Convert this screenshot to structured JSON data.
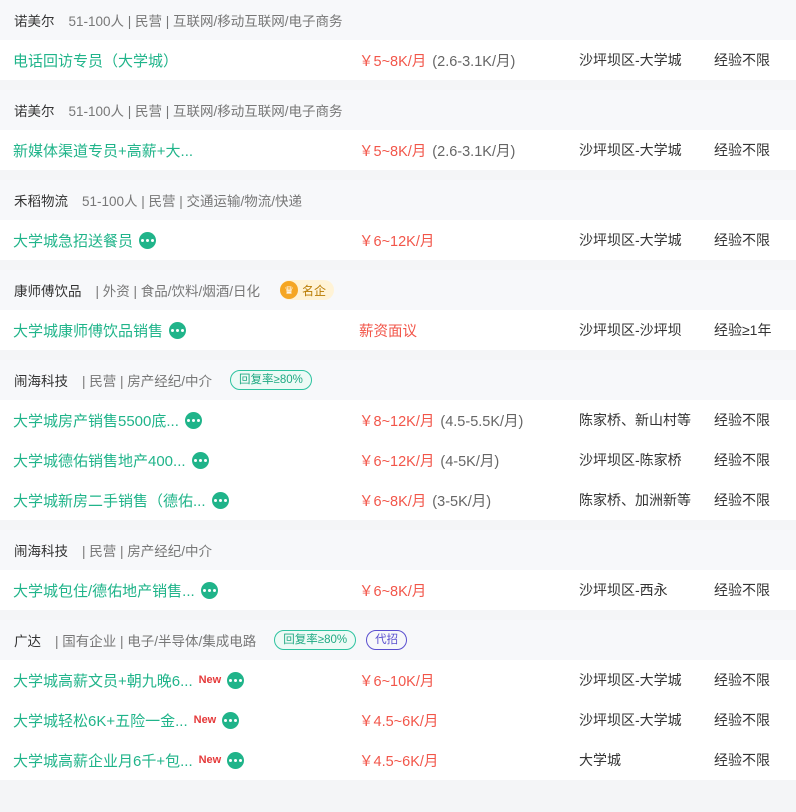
{
  "groups": [
    {
      "company": "诺美尔",
      "info": "51-100人 | 民营 | 互联网/移动互联网/电子商务",
      "jobs": [
        {
          "title": "电话回访专员（大学城）",
          "chat": false,
          "new": false,
          "salary": "￥5~8K/月",
          "salary_extra": "(2.6-3.1K/月)",
          "location": "沙坪坝区-大学城",
          "experience": "经验不限"
        }
      ]
    },
    {
      "company": "诺美尔",
      "info": "51-100人 | 民营 | 互联网/移动互联网/电子商务",
      "jobs": [
        {
          "title": "新媒体渠道专员+高薪+大...",
          "chat": false,
          "new": false,
          "salary": "￥5~8K/月",
          "salary_extra": "(2.6-3.1K/月)",
          "location": "沙坪坝区-大学城",
          "experience": "经验不限"
        }
      ]
    },
    {
      "company": "禾稻物流",
      "info": "51-100人 | 民营 | 交通运输/物流/快递",
      "jobs": [
        {
          "title": "大学城急招送餐员",
          "chat": true,
          "new": false,
          "salary": "￥6~12K/月",
          "salary_extra": "",
          "location": "沙坪坝区-大学城",
          "experience": "经验不限"
        }
      ]
    },
    {
      "company": "康师傅饮品",
      "info": "| 外资 | 食品/饮料/烟酒/日化",
      "famous_badge": "名企",
      "jobs": [
        {
          "title": "大学城康师傅饮品销售",
          "chat": true,
          "new": false,
          "salary": "薪资面议",
          "salary_extra": "",
          "location": "沙坪坝区-沙坪坝",
          "experience": "经验≥1年"
        }
      ]
    },
    {
      "company": "闹海科技",
      "info": "| 民营 | 房产经纪/中介",
      "reply_badge": "回复率≥80%",
      "jobs": [
        {
          "title": "大学城房产销售5500底...",
          "chat": true,
          "new": false,
          "salary": "￥8~12K/月",
          "salary_extra": "(4.5-5.5K/月)",
          "location": "陈家桥、新山村等",
          "experience": "经验不限"
        },
        {
          "title": "大学城德佑销售地产400...",
          "chat": true,
          "new": false,
          "salary": "￥6~12K/月",
          "salary_extra": "(4-5K/月)",
          "location": "沙坪坝区-陈家桥",
          "experience": "经验不限"
        },
        {
          "title": "大学城新房二手销售（德佑...",
          "chat": true,
          "new": false,
          "salary": "￥6~8K/月",
          "salary_extra": "(3-5K/月)",
          "location": "陈家桥、加洲新等",
          "experience": "经验不限"
        }
      ]
    },
    {
      "company": "闹海科技",
      "info": "| 民营 | 房产经纪/中介",
      "jobs": [
        {
          "title": "大学城包住/德佑地产销售...",
          "chat": true,
          "new": false,
          "salary": "￥6~8K/月",
          "salary_extra": "",
          "location": "沙坪坝区-西永",
          "experience": "经验不限"
        }
      ]
    },
    {
      "company": "广达",
      "info": "| 国有企业 | 电子/半导体/集成电路",
      "reply_badge": "回复率≥80%",
      "agent_badge": "代招",
      "jobs": [
        {
          "title": "大学城高薪文员+朝九晚6...",
          "chat": true,
          "new": true,
          "salary": "￥6~10K/月",
          "salary_extra": "",
          "location": "沙坪坝区-大学城",
          "experience": "经验不限"
        },
        {
          "title": "大学城轻松6K+五险一金...",
          "chat": true,
          "new": true,
          "salary": "￥4.5~6K/月",
          "salary_extra": "",
          "location": "沙坪坝区-大学城",
          "experience": "经验不限"
        },
        {
          "title": "大学城高薪企业月6千+包...",
          "chat": true,
          "new": true,
          "salary": "￥4.5~6K/月",
          "salary_extra": "",
          "location": "大学城",
          "experience": "经验不限"
        }
      ]
    }
  ],
  "new_label": "New",
  "colors": {
    "accent": "#20b48a",
    "salary": "#f2564a"
  }
}
